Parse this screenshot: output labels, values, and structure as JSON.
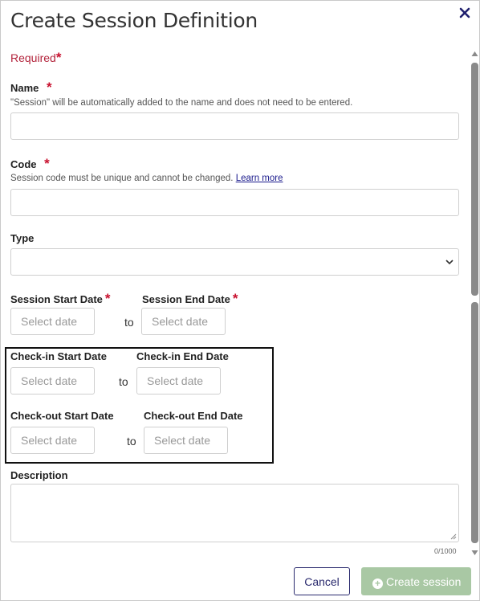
{
  "dialog": {
    "title": "Create Session Definition",
    "required_label": "Required"
  },
  "fields": {
    "name": {
      "label": "Name",
      "help": "\"Session\" will be automatically added to the name and does not need to be entered.",
      "value": ""
    },
    "code": {
      "label": "Code",
      "help": "Session code must be unique and cannot be changed.",
      "help_link": "Learn more",
      "value": ""
    },
    "type": {
      "label": "Type",
      "value": ""
    },
    "session_start": {
      "label": "Session Start Date",
      "placeholder": "Select date"
    },
    "session_end": {
      "label": "Session End Date",
      "placeholder": "Select date"
    },
    "checkin_start": {
      "label": "Check-in Start Date",
      "placeholder": "Select date"
    },
    "checkin_end": {
      "label": "Check-in End Date",
      "placeholder": "Select date"
    },
    "checkout_start": {
      "label": "Check-out Start Date",
      "placeholder": "Select date"
    },
    "checkout_end": {
      "label": "Check-out End Date",
      "placeholder": "Select date"
    },
    "range_separator": "to",
    "description": {
      "label": "Description",
      "value": "",
      "counter": "0/1000"
    }
  },
  "icons": {
    "close": "close-icon",
    "select_chevron": "chevron-down-icon",
    "create": "plus-circle-icon"
  },
  "buttons": {
    "cancel": "Cancel",
    "create": "Create session"
  },
  "colors": {
    "required": "#c8102e",
    "primary": "#2a2a6e",
    "create_disabled": "#a9c8a4"
  }
}
